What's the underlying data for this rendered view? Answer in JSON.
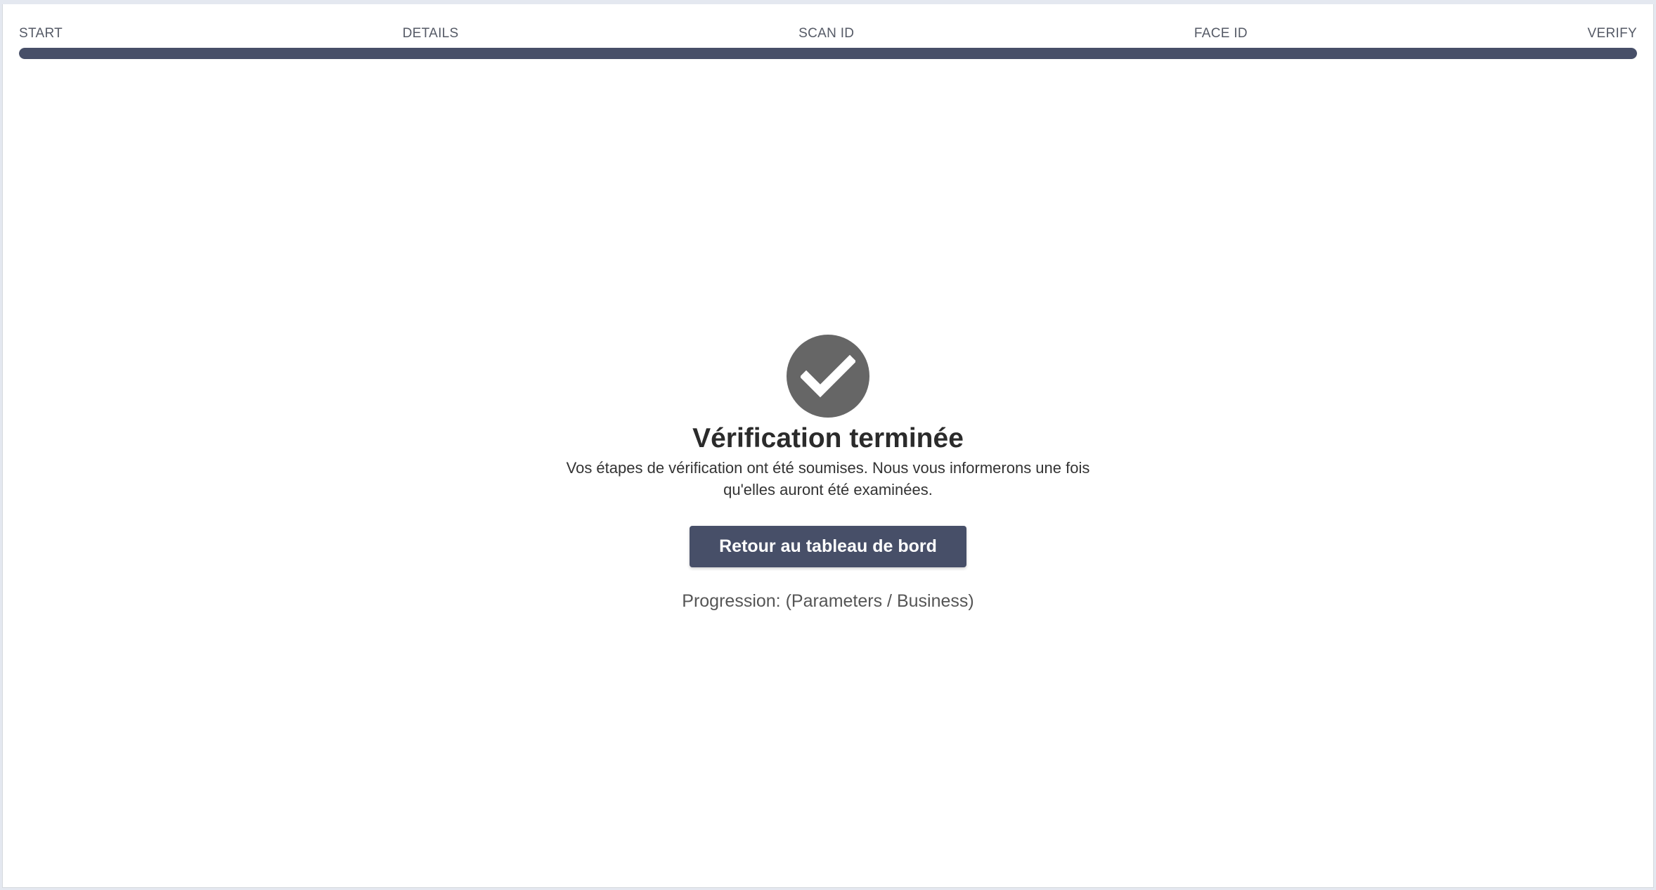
{
  "stepper": {
    "steps": [
      {
        "label": "START"
      },
      {
        "label": "DETAILS"
      },
      {
        "label": "SCAN ID"
      },
      {
        "label": "FACE ID"
      },
      {
        "label": "VERIFY"
      }
    ],
    "progress_percent": 100,
    "progress_color": "#474f68"
  },
  "completion": {
    "icon": "check-circle-icon",
    "icon_color": "#666666",
    "title": "Vérification terminée",
    "message_line1": "Vos étapes de vérification ont été soumises. Nous vous informerons une fois",
    "message_line2": "qu'elles auront été examinées.",
    "button_label": "Retour au tableau de bord",
    "button_color": "#474f68",
    "progression_text": "Progression: (Parameters / Business)"
  }
}
